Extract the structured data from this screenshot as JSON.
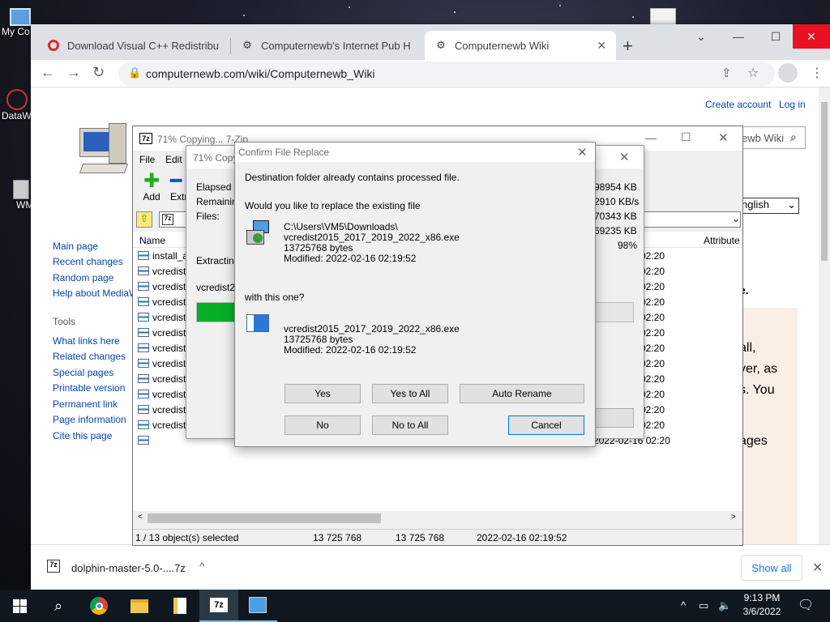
{
  "desktop": {
    "icons": [
      {
        "label": "My Co"
      },
      {
        "label": "DataW"
      },
      {
        "label": "WM"
      }
    ]
  },
  "browser": {
    "tabs": [
      {
        "label": "Download Visual C++ Redistribu",
        "icon": "opera-like-icon",
        "active": false
      },
      {
        "label": "Computernewb's Internet Pub H",
        "icon": "puzzle-icon",
        "active": false
      },
      {
        "label": "Computernewb Wiki",
        "icon": "puzzle-icon",
        "active": true
      }
    ],
    "new_tab": "+",
    "window_controls": {
      "minimize": "—",
      "maximize": "☐",
      "close": "✕",
      "collapse": "⌄"
    },
    "url": "computernewb.com/wiki/Computernewb_Wiki"
  },
  "wiki": {
    "top_links": {
      "create_account": "Create account",
      "login": "Log in"
    },
    "search_fragment": "ewb Wiki",
    "lang_fragment": "nglish",
    "nav": [
      "Main page",
      "Recent changes",
      "Random page",
      "Help about MediaW"
    ],
    "tools_heading": "Tools",
    "tools": [
      "What links here",
      "Related changes",
      "Special pages",
      "Printable version",
      "Permanent link",
      "Page information",
      "Cite this page"
    ],
    "body_fragments": [
      "e.",
      "all,",
      "ver, as",
      "s. You",
      "ages"
    ]
  },
  "downloads": {
    "file": "dolphin-master-5.0-....7z",
    "show_all": "Show all"
  },
  "sevenzip": {
    "title": "71% Copying... 7-Zip",
    "menu": [
      "File",
      "Edit"
    ],
    "toolbar": [
      "Add",
      "Extr"
    ],
    "columns": {
      "name": "Name",
      "attributes": "Attribute"
    },
    "rows": [
      {
        "name": "install_a",
        "date": "02:20"
      },
      {
        "name": "vcredist",
        "date": "02:20"
      },
      {
        "name": "vcredist",
        "date": "02:20"
      },
      {
        "name": "vcredist",
        "date": "02:20"
      },
      {
        "name": "vcredist",
        "date": "02:20"
      },
      {
        "name": "vcredist",
        "date": "02:20"
      },
      {
        "name": "vcredist",
        "date": "02:20"
      },
      {
        "name": "vcredist",
        "date": "02:20"
      },
      {
        "name": "vcredist",
        "date": "02:20"
      },
      {
        "name": "vcredist",
        "date": "02:20"
      },
      {
        "name": "vcredist",
        "date": "02:20"
      },
      {
        "name": "vcredist",
        "date": "02:20"
      },
      {
        "name": "",
        "date": "2022-02-16 02:20"
      }
    ],
    "status": {
      "selected": "1 / 13 object(s) selected",
      "size": "13 725 768",
      "packed": "13 725 768",
      "modified": "2022-02-16 02:19:52"
    }
  },
  "progress": {
    "title": "71% Copy",
    "labels": [
      "Elapsed ti",
      "Remaining",
      "Files:"
    ],
    "values": [
      "98954 KB",
      "2910 KB/s",
      "70343 KB",
      "69235 KB",
      "98%"
    ],
    "extracting": "Extracting",
    "file_fragment": "vcredist20",
    "fill_percent": 71
  },
  "confirm": {
    "title": "Confirm File Replace",
    "line1": "Destination folder already contains processed file.",
    "line2": "Would you like to replace the existing file",
    "existing": {
      "path": "C:\\Users\\VM5\\Downloads\\",
      "name": "vcredist2015_2017_2019_2022_x86.exe",
      "size": "13725768 bytes",
      "modified": "Modified: 2022-02-16 02:19:52"
    },
    "with": "with this one?",
    "new": {
      "name": "vcredist2015_2017_2019_2022_x86.exe",
      "size": "13725768 bytes",
      "modified": "Modified: 2022-02-16 02:19:52"
    },
    "buttons": {
      "yes": "Yes",
      "yes_all": "Yes to All",
      "auto_rename": "Auto Rename",
      "no": "No",
      "no_all": "No to All",
      "cancel": "Cancel"
    }
  },
  "taskbar": {
    "time": "9:13 PM",
    "date": "3/6/2022"
  }
}
